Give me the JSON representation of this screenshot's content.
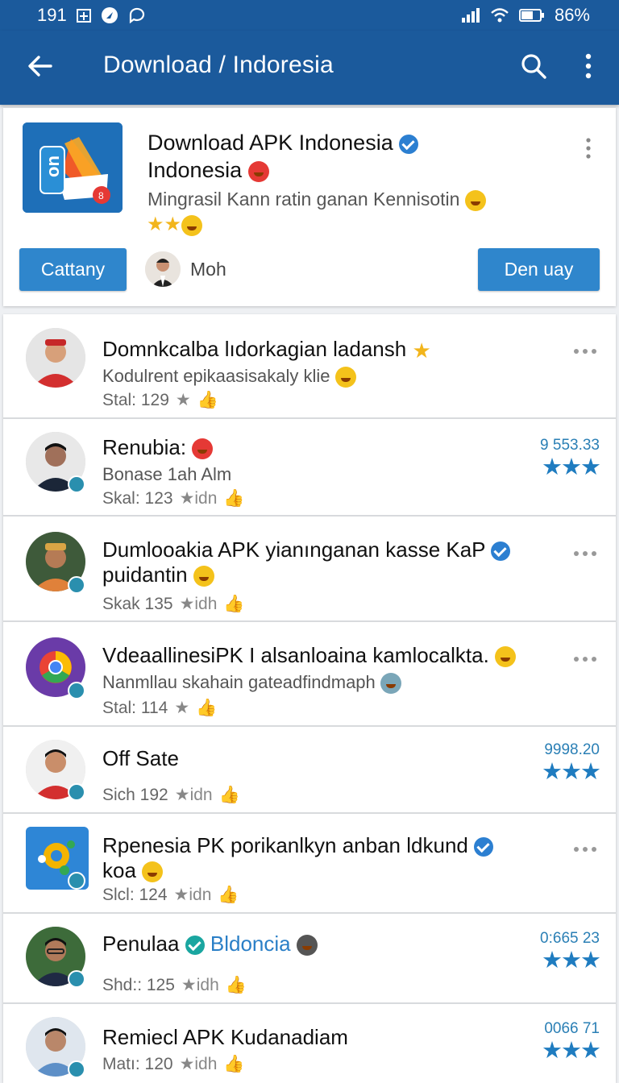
{
  "status_bar": {
    "time": "191",
    "battery": "86%"
  },
  "app_bar": {
    "title": "Download / Indoresia"
  },
  "featured": {
    "title_line1": "Download APK Indonesia",
    "title_line2": "Indonesia",
    "subtitle": "Mingrasil Kann ratin ganan Kennisotin",
    "left_button": "Cattany",
    "user_name": "Moh",
    "right_button": "Den uay",
    "icon_letters": "on"
  },
  "rows": [
    {
      "title": "Domnkcalba lıdorkagian ladansh",
      "subtitle": "Kodulrent epikaasisakaly klie",
      "meta": "Stal: 129",
      "meta_extra": ""
    },
    {
      "title": "Renubia:",
      "subtitle": "Bonase 1ah Alm",
      "meta": "Skal: 123",
      "meta_extra": "idn",
      "value": "9 553.33"
    },
    {
      "title": "Dumlooakia APK yianınganan kasse KaP",
      "title2": "puidantin",
      "meta": "Skak 135",
      "meta_extra": "idh"
    },
    {
      "title": "VdeaallinesiPK I alsanloaina kamlocalkta.",
      "subtitle": "Nanmllau skahain gateadfindmaph",
      "meta": "Stal: 114",
      "meta_extra": ""
    },
    {
      "title": "Off Sate",
      "meta": "Sich 192",
      "meta_extra": "idn",
      "value": "9998.20"
    },
    {
      "title": "Rpenesia PK porikanlkyn anban ldkund",
      "title2": "koa",
      "meta": "Slcl: 124",
      "meta_extra": "idn"
    },
    {
      "title": "Penulaa",
      "title_link": "Bldoncia",
      "meta": "Shd:: 125",
      "meta_extra": "idh",
      "value": "0:665 23"
    },
    {
      "title": "Remiecl APK Kudanadiam",
      "meta": "Matı: 120",
      "meta_extra": "idh",
      "value": "0066 71"
    }
  ],
  "colors": {
    "primary": "#1b5a9c",
    "button": "#2f86cc",
    "star_blue": "#1f7cc0",
    "star_gold": "#f2b51c"
  }
}
